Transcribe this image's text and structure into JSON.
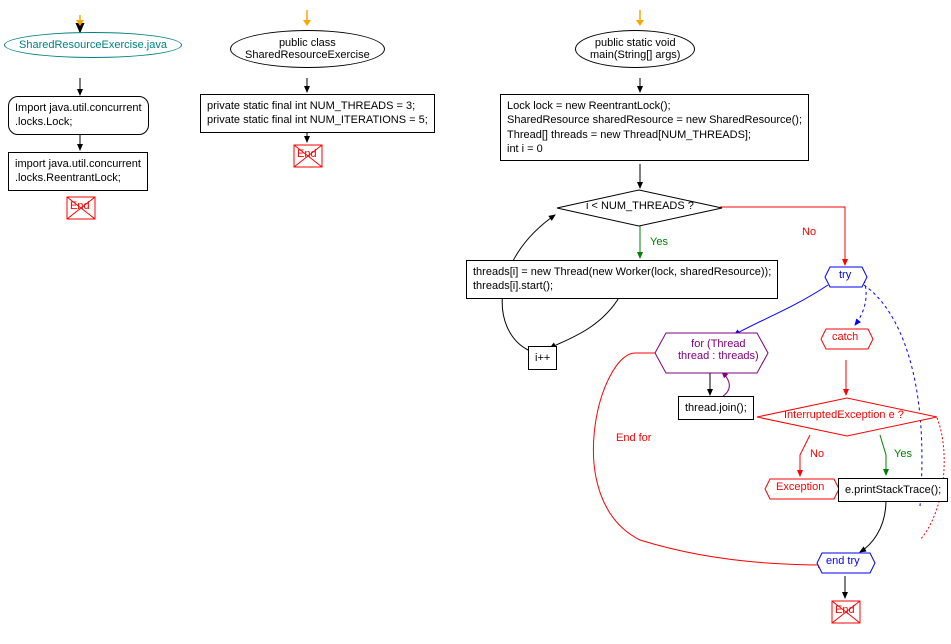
{
  "flowchart1": {
    "title": "SharedResourceExercise.java",
    "node1": "Import java.util.concurrent\n.locks.Lock;",
    "node2": "import java.util.concurrent\n.locks.ReentrantLock;",
    "end": "End"
  },
  "flowchart2": {
    "title": "public class\nSharedResourceExercise",
    "fields": "private static final int NUM_THREADS = 3;\nprivate static final int NUM_ITERATIONS = 5;",
    "end": "End"
  },
  "flowchart3": {
    "title": "public static void\nmain(String[] args)",
    "init": "Lock lock = new ReentrantLock();\nSharedResource sharedResource = new SharedResource();\nThread[] threads = new Thread[NUM_THREADS];\nint i = 0",
    "cond1": "i < NUM_THREADS ?",
    "body1": "threads[i] = new Thread(new Worker(lock, sharedResource));\nthreads[i].start();",
    "inc": "i++",
    "try": "try",
    "for": "for (Thread\nthread : threads)",
    "join": "thread.join();",
    "endfor": "End for",
    "catch": "catch",
    "intr": "InterruptedException e ?",
    "printStack": "e.printStackTrace();",
    "exception": "Exception",
    "endtry": "end try",
    "end": "End",
    "yes": "Yes",
    "no": "No"
  },
  "chart_data": {
    "type": "flowchart",
    "charts": [
      {
        "title": "SharedResourceExercise.java",
        "nodes": [
          {
            "id": "start1",
            "type": "start"
          },
          {
            "id": "imp1",
            "type": "ellipse",
            "text": "Import java.util.concurrent.locks.Lock;"
          },
          {
            "id": "imp2",
            "type": "process",
            "text": "import java.util.concurrent.locks.ReentrantLock;"
          },
          {
            "id": "end1",
            "type": "end",
            "text": "End"
          }
        ],
        "edges": [
          [
            "start1",
            "imp1"
          ],
          [
            "imp1",
            "imp2"
          ],
          [
            "imp2",
            "end1"
          ]
        ]
      },
      {
        "title": "public class SharedResourceExercise",
        "nodes": [
          {
            "id": "start2",
            "type": "start"
          },
          {
            "id": "cls",
            "type": "ellipse",
            "text": "public class SharedResourceExercise"
          },
          {
            "id": "fields",
            "type": "process",
            "text": "private static final int NUM_THREADS = 3; private static final int NUM_ITERATIONS = 5;"
          },
          {
            "id": "end2",
            "type": "end",
            "text": "End"
          }
        ],
        "edges": [
          [
            "start2",
            "cls"
          ],
          [
            "cls",
            "fields"
          ],
          [
            "fields",
            "end2"
          ]
        ]
      },
      {
        "title": "public static void main(String[] args)",
        "nodes": [
          {
            "id": "start3",
            "type": "start"
          },
          {
            "id": "mainEl",
            "type": "ellipse",
            "text": "public static void main(String[] args)"
          },
          {
            "id": "init",
            "type": "process",
            "text": "Lock lock = new ReentrantLock(); SharedResource sharedResource = new SharedResource(); Thread[] threads = new Thread[NUM_THREADS]; int i = 0"
          },
          {
            "id": "cond",
            "type": "decision",
            "text": "i < NUM_THREADS ?"
          },
          {
            "id": "body",
            "type": "process",
            "text": "threads[i] = new Thread(new Worker(lock, sharedResource)); threads[i].start();"
          },
          {
            "id": "inc",
            "type": "process",
            "text": "i++"
          },
          {
            "id": "try",
            "type": "preparation",
            "text": "try"
          },
          {
            "id": "for",
            "type": "preparation",
            "text": "for (Thread thread : threads)"
          },
          {
            "id": "join",
            "type": "process",
            "text": "thread.join();"
          },
          {
            "id": "catch",
            "type": "preparation",
            "text": "catch"
          },
          {
            "id": "intr",
            "type": "decision",
            "text": "InterruptedException e ?"
          },
          {
            "id": "pst",
            "type": "process",
            "text": "e.printStackTrace();"
          },
          {
            "id": "exc",
            "type": "exception",
            "text": "Exception"
          },
          {
            "id": "endtry",
            "type": "preparation",
            "text": "end try"
          },
          {
            "id": "end3",
            "type": "end",
            "text": "End"
          }
        ],
        "edges": [
          [
            "start3",
            "mainEl"
          ],
          [
            "mainEl",
            "init"
          ],
          [
            "init",
            "cond"
          ],
          [
            "cond",
            "body",
            "Yes"
          ],
          [
            "body",
            "inc"
          ],
          [
            "inc",
            "cond"
          ],
          [
            "cond",
            "try",
            "No"
          ],
          [
            "try",
            "for"
          ],
          [
            "for",
            "join"
          ],
          [
            "join",
            "for"
          ],
          [
            "for",
            "endtry",
            "End for"
          ],
          [
            "try",
            "catch"
          ],
          [
            "catch",
            "intr"
          ],
          [
            "intr",
            "pst",
            "Yes"
          ],
          [
            "intr",
            "exc",
            "No"
          ],
          [
            "pst",
            "endtry"
          ],
          [
            "endtry",
            "end3"
          ]
        ]
      }
    ]
  }
}
